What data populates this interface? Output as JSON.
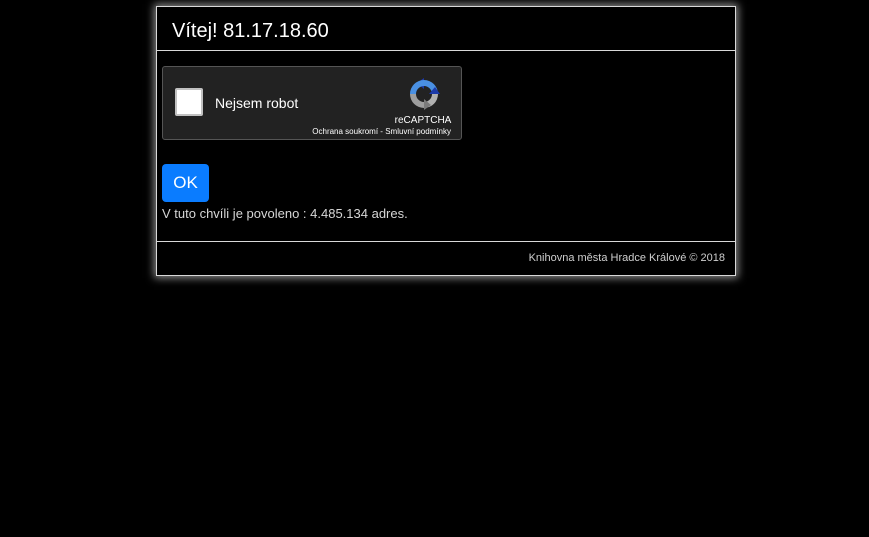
{
  "header": {
    "title": "Vítej! 81.17.18.60"
  },
  "captcha": {
    "label": "Nejsem robot",
    "brand": "reCAPTCHA",
    "privacy_link": "Ochrana soukromí",
    "separator": " - ",
    "terms_link": "Smluvní podmínky",
    "checked": false,
    "logo_icon": "recaptcha-logo-icon"
  },
  "form": {
    "ok_label": "OK",
    "status_text": "V tuto chvíli je povoleno : 4.485.134 adres."
  },
  "footer": {
    "text": "Knihovna města Hradce Králové © 2018"
  },
  "colors": {
    "background": "#000000",
    "ok_button": "#0a7cff",
    "border": "#d9d9d9"
  }
}
